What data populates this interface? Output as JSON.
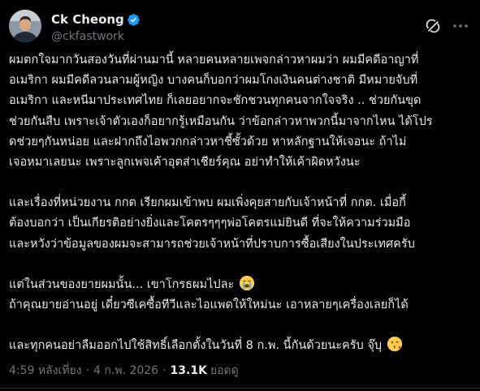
{
  "author": {
    "display_name": "Ck Cheong",
    "handle": "@ckfastwork",
    "verified": true,
    "avatar": "avatar-image"
  },
  "icons": {
    "verified": "verified-badge-icon",
    "grok": "grok-icon",
    "more": "more-options-icon"
  },
  "colors": {
    "background": "#000000",
    "text": "#e7e9ea",
    "muted": "#71767b",
    "verified": "#1d9bf0"
  },
  "post": {
    "paragraph_1": [
      "ผมตกใจมากวันสองวันที่ผ่านมานี้ หลายคนหลายเพจกล่าวหาผมว่า ผมมีคดีอาญาที่",
      "อเมริกา ผมมีคดีลวนลามผู้หญิง บางคนก็บอกว่าผมโกงเงินคนต่างชาติ มีหมายจับที่",
      "อเมริกา และหนีมาประเทศไทย ก็เลยอยากจะชักชวนทุกคนจากใจจริง .. ช่วยกันขุด",
      "ช่วยกันสืบ เพราะเจ้าตัวเองก็อยากรู้เหมือนกัน ว่าข้อกล่าวหาพวกนี้มาจากไหน ได้โปร",
      "ดช่วยๆกันหน่อย และฝากถึงไอพวกกล่าวหาชี้ซั้วด้วย หาหลักฐานให้เจอนะ ถ้าไม่",
      "เจอหมาเลยนะ เพราะลูกเพจเค้าอุตส่าเชียร์คุณ อย่าทำให้เค้าผิดหวังนะ"
    ],
    "paragraph_2": [
      "และเรื่องที่หน่วยงาน กกต เรียกผมเข้าพบ ผมเพิ่งคุยสายกับเจ้าหน้าที่ กกต. เมื่อกี้",
      "ต้องบอกว่า เป็นเกียรติอย่างยิ่งและโคตรๆๆๆพ่อโคตรแม่ยินดี ที่จะให้ความร่วมมือ",
      "และหวังว่าข้อมูลของผมจะสามารถช่วยเจ้าหน้าที่ปราบการซื้อเสียงในประเทศครับ"
    ],
    "paragraph_3_line_1": "แต่ในส่วนของยายผมนั้น... เขาโกรธผมไปละ",
    "paragraph_3_line_2": "ถ้าคุณยายอ่านอยู่ เดี๋ยวซีเคซื้อทีวีและไอแพดให้ใหม่นะ เอาหลายๆเครื่องเลยก็ได้",
    "paragraph_4": "และทุกคนอย่าลืมออกไปใช้สิทธิ์เลือกตั้งในวันที่ 8 ก.พ. นี้กันด้วยนะครับ จุ๊บุ",
    "emoji_1": "loudly-crying-face-emoji",
    "emoji_2": "face-blowing-kiss-emoji"
  },
  "meta": {
    "time": "4:59 หลังเที่ยง",
    "separator": "·",
    "date": "4 ก.พ. 2026",
    "views_count": "13.1K",
    "views_label": "ยอดดู"
  }
}
